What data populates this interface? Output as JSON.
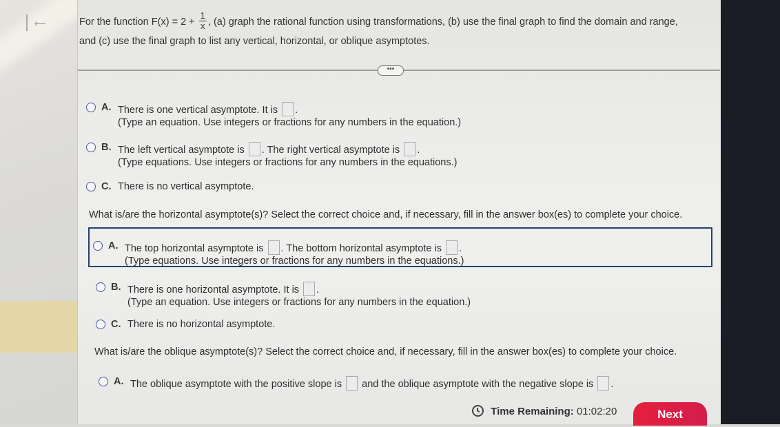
{
  "nav": {
    "back_icon": "back-arrow-icon"
  },
  "problem": {
    "prefix": "For the function F(x) = 2 +",
    "fraction_numerator": "1",
    "fraction_denominator": "x",
    "suffix": ", (a) graph the rational function using transformations, (b) use the final graph to find the domain and range,",
    "line2": "and (c) use the final graph to list any vertical, horizontal, or oblique asymptotes."
  },
  "divider": {
    "more_label": "•••"
  },
  "vertical": {
    "choices": [
      {
        "letter": "A.",
        "text_before": "There is one vertical asymptote. It is",
        "text_after": ".",
        "hint": "(Type an equation. Use integers or fractions for any numbers in the equation.)",
        "selected": false
      },
      {
        "letter": "B.",
        "text_before": "The left vertical asymptote is",
        "text_middle": ". The right vertical asymptote is",
        "text_after": ".",
        "hint": "(Type equations. Use integers or fractions for any numbers in the equations.)",
        "selected": false
      },
      {
        "letter": "C.",
        "text": "There is no vertical asymptote.",
        "selected": false
      }
    ]
  },
  "horizontal": {
    "question": "What is/are the horizontal asymptote(s)? Select the correct choice and, if necessary, fill in the answer box(es) to complete your choice.",
    "choices": [
      {
        "letter": "A.",
        "text_before": "The top horizontal asymptote is",
        "text_middle": ". The bottom horizontal asymptote is",
        "text_after": ".",
        "hint": "(Type equations. Use integers or fractions for any numbers in the equations.)",
        "selected": false
      },
      {
        "letter": "B.",
        "text_before": "There is one horizontal asymptote. It is",
        "text_after": ".",
        "hint": "(Type an equation. Use integers or fractions for any numbers in the equation.)",
        "selected": false
      },
      {
        "letter": "C.",
        "text": "There is no horizontal asymptote.",
        "selected": false
      }
    ]
  },
  "oblique": {
    "question": "What is/are the oblique asymptote(s)? Select the correct choice and, if necessary, fill in the answer box(es) to complete your choice.",
    "choices": [
      {
        "letter": "A.",
        "text_before": "The oblique asymptote with the positive slope is",
        "text_middle": "and the oblique asymptote with the negative slope is",
        "text_after": ".",
        "selected": false
      }
    ]
  },
  "footer": {
    "timer_label": "Time Remaining:",
    "timer_value": "01:02:20",
    "next_label": "Next"
  },
  "colors": {
    "next_button": "#e4203f",
    "radio_border": "#4b5aa3",
    "focus_border": "#24426e",
    "left_highlight": "#e3d7a8"
  }
}
